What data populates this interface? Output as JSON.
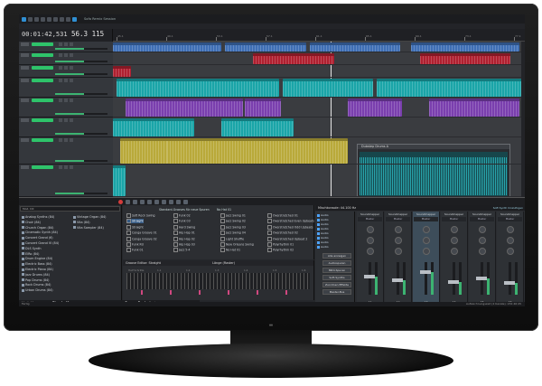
{
  "app": {
    "title": "Sofa Remix Session"
  },
  "transport": {
    "timecode": "00:01:42,531",
    "bpm": "56.3 115"
  },
  "ruler": {
    "marks": [
      "45.1",
      "49.1",
      "53.1",
      "57.1",
      "61.1",
      "65.1",
      "69.1",
      "73.1",
      "77.1"
    ]
  },
  "editor_window": {
    "title": "Dubstep Drums A"
  },
  "instruments": {
    "search": "Mod. DX",
    "items": [
      "Analog Synths (84)",
      "Choir (84)",
      "Church Organ (84)",
      "Cinematic Synth (84)",
      "Concert Grand (6)",
      "Concert Grand VI (84)",
      "DLS Synth",
      "ElRo (84)",
      "Drum Engine (84)",
      "Electric Bass (84)",
      "Electric Piano (84)",
      "Jazz Drums (84)",
      "Pop Drums (84)",
      "Rock Drums (84)",
      "Urban Drums (84)"
    ],
    "col2": [
      "Vintage Organ (84)",
      "Vita (84)",
      "Vita Sampler (84)"
    ]
  },
  "bottom_tabs": [
    "MediaManager",
    "Plug-In-Manager"
  ],
  "grooves": {
    "header": [
      "Standard-Grooves für neue Spuren",
      "No Hat 01"
    ],
    "col1": [
      "Soft Rock Swing",
      "Straight",
      "Straight",
      "Conga Groove 01",
      "Conga Groove 02",
      "Funk Rd",
      "Funk 01"
    ],
    "col2": [
      "Funk 02",
      "Funk 03",
      "Hard Swing",
      "Hip Hop 01",
      "Hip Hop 02",
      "Hip Hop 03",
      "Jazz 5-4"
    ],
    "col3": [
      "Jazz Swing 01",
      "Jazz Swing 02",
      "Jazz Swing 03",
      "Jazz Swing 04",
      "Light Shuffle",
      "New Orleans Swing",
      "No Hat 01"
    ],
    "col4": [
      "Overstretched 01",
      "Overstretched Even Upbeats",
      "Overstretched Odd Upbeats",
      "Overstretched 02",
      "Overstretched Upbeat 2",
      "Polyrhythm 01",
      "Polyrhythm 02"
    ],
    "selected": "Straight"
  },
  "groove_editor": {
    "title": "Groove Editor: Straight",
    "length": "Länge (Raster)",
    "marks": [
      "Half Schritte",
      "1.1",
      "1.2",
      "1.3",
      "1.4",
      "1.5",
      "1.6"
    ],
    "tabs": [
      "Groove Pool",
      "Explorer"
    ]
  },
  "mixer": {
    "title": "Mischkonsole: 44.100 Hz",
    "tracks": [
      "Audio",
      "Audio",
      "Audio",
      "Audio",
      "Audio",
      "Audio",
      "Audio",
      "Audio"
    ],
    "buttons": [
      "Alle anzeigen",
      "Audiospuren",
      "MIDI-Spuren",
      "Soft-Synths",
      "Zuordnen Effekte",
      "Master-Bus"
    ],
    "channels": [
      {
        "label": "Soundmapper",
        "sub": "Master",
        "name": "A1",
        "level": 0.55
      },
      {
        "label": "Soundmapper",
        "sub": "Master",
        "name": "A2",
        "level": 0.45
      },
      {
        "label": "Soundmapper",
        "sub": "Master",
        "name": "A3",
        "level": 0.7
      },
      {
        "label": "Soundmapper",
        "sub": "Master",
        "name": "A4",
        "level": 0.4
      },
      {
        "label": "Soundmapper",
        "sub": "Master",
        "name": "A5",
        "level": 0.5
      },
      {
        "label": "Soundmapper",
        "sub": "Master",
        "name": "A6",
        "level": 0.35
      }
    ],
    "softsynth": "Soft Synth hinzufügen",
    "preset": "Microsoft Sound..."
  },
  "status": {
    "left": "Fertig",
    "right": "Aufzeichnungszeit (2 Kanäle): 232:46:45"
  },
  "colors": {
    "green": "#2ec36a",
    "blue": "#3f6fb5",
    "red": "#b02030",
    "teal": "#1aa5a8",
    "purple": "#7a3fae",
    "yellow": "#b9a93a"
  }
}
